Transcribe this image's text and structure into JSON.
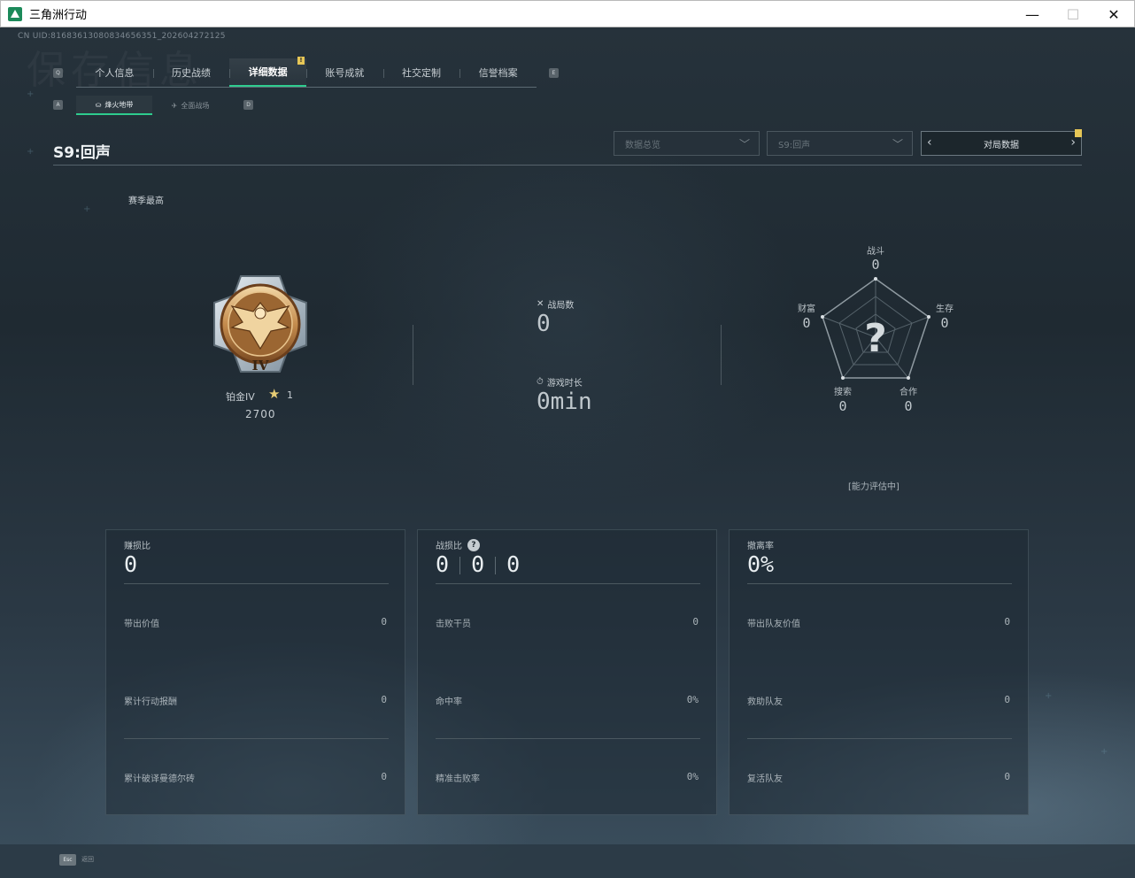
{
  "window": {
    "title": "三角洲行动",
    "minimize": "—",
    "maximize": "☐",
    "close": "✕"
  },
  "header": {
    "uid": "CN UID:81683613080834656351_202604272125",
    "watermark": "保存信息"
  },
  "tabs": {
    "left_key": "Q",
    "right_key": "E",
    "items": [
      {
        "label": "个人信息"
      },
      {
        "label": "历史战绩"
      },
      {
        "label": "详细数据",
        "badge": "!"
      },
      {
        "label": "账号成就"
      },
      {
        "label": "社交定制"
      },
      {
        "label": "信誉档案"
      }
    ]
  },
  "subtabs": {
    "left_key": "A",
    "right_key": "D",
    "items": [
      {
        "label": "烽火地带"
      },
      {
        "label": "全面战场"
      }
    ]
  },
  "season": {
    "title": "S9:回声",
    "best_label": "赛季最高"
  },
  "filters": {
    "data_scope": "数据总览",
    "season_select": "S9:回声",
    "match_nav_label": "对局数据"
  },
  "rank": {
    "name": "铂金IV",
    "stars": "1",
    "score": "2700",
    "emblem_numeral": "IV"
  },
  "stats": {
    "matches_label": "战局数",
    "matches_value": "0",
    "playtime_label": "游戏时长",
    "playtime_value": "0min"
  },
  "radar": {
    "combat_label": "战斗",
    "combat_value": "0",
    "survival_label": "生存",
    "survival_value": "0",
    "cooperation_label": "合作",
    "cooperation_value": "0",
    "search_label": "搜索",
    "search_value": "0",
    "wealth_label": "财富",
    "wealth_value": "0",
    "center_symbol": "?",
    "note": "[能力评估中]"
  },
  "cards": [
    {
      "title": "赚损比",
      "big": "0",
      "rows": [
        {
          "label": "带出价值",
          "value": "0"
        },
        {
          "label": "累计行动报酬",
          "value": "0"
        },
        {
          "label": "累计破译曼德尔砖",
          "value": "0"
        }
      ]
    },
    {
      "title": "战损比",
      "help": "?",
      "big_values": [
        "0",
        "0",
        "0"
      ],
      "rows": [
        {
          "label": "击败干员",
          "value": "0"
        },
        {
          "label": "命中率",
          "value": "0%"
        },
        {
          "label": "精准击败率",
          "value": "0%"
        }
      ]
    },
    {
      "title": "撤离率",
      "big": "0%",
      "rows": [
        {
          "label": "带出队友价值",
          "value": "0"
        },
        {
          "label": "救助队友",
          "value": "0"
        },
        {
          "label": "复活队友",
          "value": "0"
        }
      ]
    }
  ],
  "footer": {
    "esc_key": "Esc",
    "esc_label": "返回"
  },
  "colors": {
    "accent": "#2ecc8e",
    "badge": "#e6c656",
    "background": "#1f2a32"
  }
}
